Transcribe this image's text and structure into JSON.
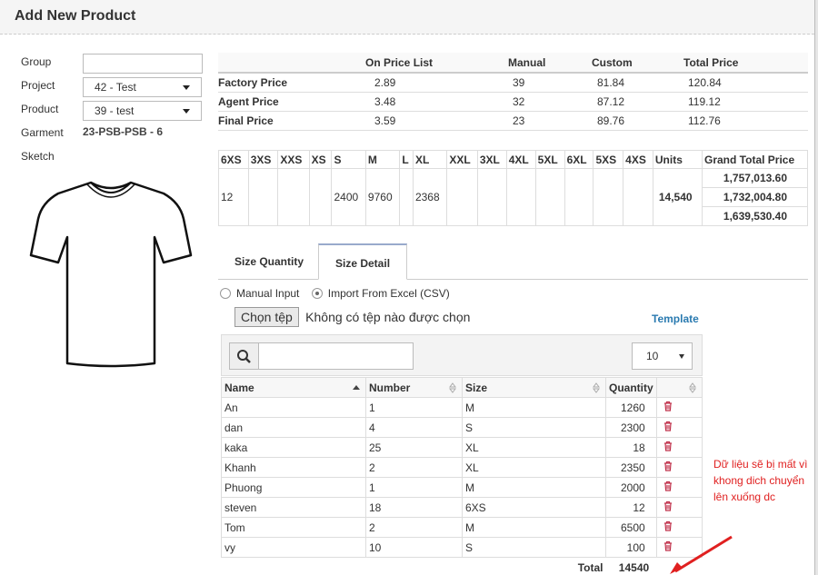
{
  "modal": {
    "title": "Add New Product"
  },
  "form": {
    "group_label": "Group",
    "group_value": "",
    "project_label": "Project",
    "project_value": "42 - Test",
    "product_label": "Product",
    "product_value": "39 - test",
    "garment_label": "Garment",
    "garment_value": "23-PSB-PSB - 6",
    "sketch_label": "Sketch"
  },
  "price_table": {
    "headers": [
      "",
      "On Price List",
      "Manual",
      "Custom",
      "Total Price"
    ],
    "rows": [
      {
        "name": "Factory Price",
        "on_price_list": "2.89",
        "manual": "39",
        "custom": "81.84",
        "total": "120.84"
      },
      {
        "name": "Agent Price",
        "on_price_list": "3.48",
        "manual": "32",
        "custom": "87.12",
        "total": "119.12"
      },
      {
        "name": "Final Price",
        "on_price_list": "3.59",
        "manual": "23",
        "custom": "89.76",
        "total": "112.76"
      }
    ]
  },
  "size_table": {
    "headers": [
      "6XS",
      "3XS",
      "XXS",
      "XS",
      "S",
      "M",
      "L",
      "XL",
      "XXL",
      "3XL",
      "4XL",
      "5XL",
      "6XL",
      "5XS",
      "4XS",
      "Units",
      "Grand Total Price"
    ],
    "values": [
      "12",
      "",
      "",
      "",
      "2400",
      "9760",
      "",
      "2368",
      "",
      "",
      "",
      "",
      "",
      "",
      "",
      "14,540"
    ],
    "grand_totals": [
      "1,757,013.60",
      "1,732,004.80",
      "1,639,530.40"
    ]
  },
  "tabs": [
    "Size Quantity",
    "Size Detail"
  ],
  "import": {
    "manual_label": "Manual Input",
    "excel_label": "Import From Excel (CSV)",
    "file_button": "Chọn tệp",
    "file_status": "Không có tệp nào được chọn",
    "template_link": "Template"
  },
  "grid": {
    "search_placeholder": "",
    "page_size": "10",
    "columns": [
      "Name",
      "Number",
      "Size",
      "Quantity"
    ],
    "rows": [
      {
        "name": "An",
        "number": "1",
        "size": "M",
        "quantity": "1260"
      },
      {
        "name": "dan",
        "number": "4",
        "size": "S",
        "quantity": "2300"
      },
      {
        "name": "kaka",
        "number": "25",
        "size": "XL",
        "quantity": "18"
      },
      {
        "name": "Khanh",
        "number": "2",
        "size": "XL",
        "quantity": "2350"
      },
      {
        "name": "Phuong",
        "number": "1",
        "size": "M",
        "quantity": "2000"
      },
      {
        "name": "steven",
        "number": "18",
        "size": "6XS",
        "quantity": "12"
      },
      {
        "name": "Tom",
        "number": "2",
        "size": "M",
        "quantity": "6500"
      },
      {
        "name": "vy",
        "number": "10",
        "size": "S",
        "quantity": "100"
      }
    ],
    "total_label": "Total",
    "total_value": "14540"
  },
  "annotation": {
    "note": "Dữ liệu sẽ bị mất vì khong dich chuyển lên xuống dc",
    "color": "#e02020"
  }
}
